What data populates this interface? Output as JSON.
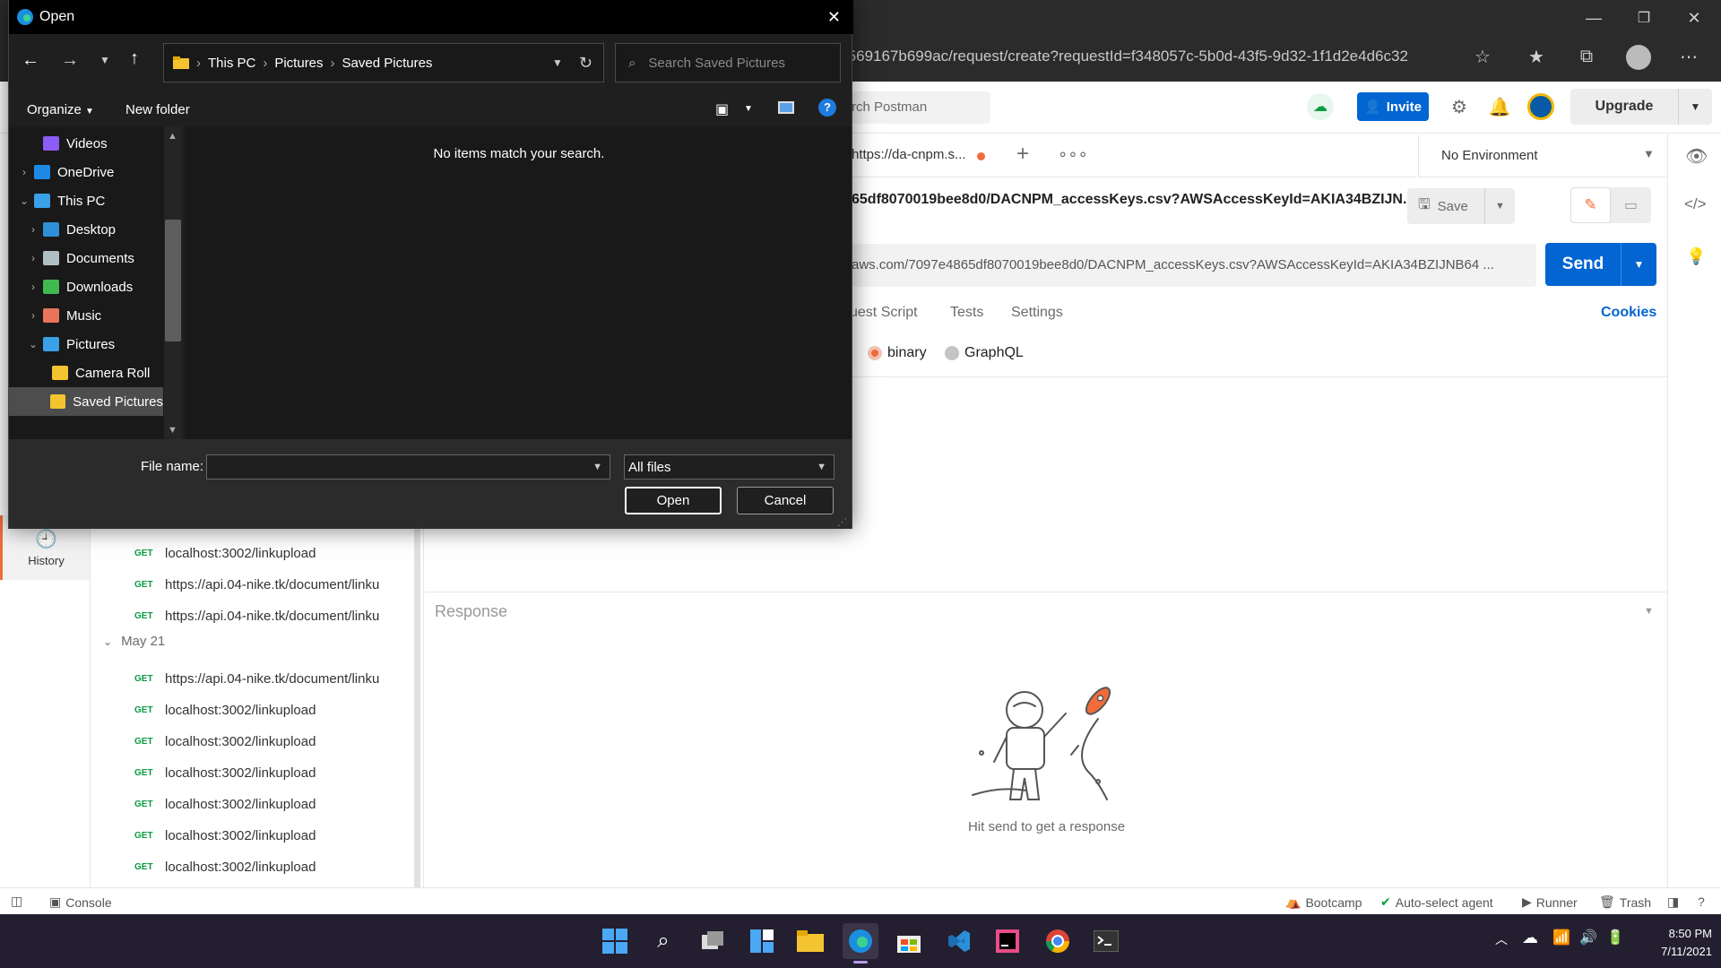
{
  "browser": {
    "url": "-569167b699ac/request/create?requestId=f348057c-5b0d-43f5-9d32-1f1d2e4d6c32"
  },
  "postman": {
    "search_placeholder": "rch Postman",
    "invite_label": "Invite",
    "upgrade_label": "Upgrade",
    "tab_label": "https://da-cnpm.s...",
    "environment": "No Environment",
    "request_name": "65df8070019bee8d0/DACNPM_accessKeys.csv?AWSAccessKeyId=AKIA34BZIJN...",
    "save_label": "Save",
    "request_url": "aws.com/7097e4865df8070019bee8d0/DACNPM_accessKeys.csv?AWSAccessKeyId=AKIA34BZIJNB64 ...",
    "send_label": "Send",
    "request_tabs": [
      "uest Script",
      "Tests",
      "Settings"
    ],
    "cookies_label": "Cookies",
    "body_types": [
      "binary",
      "GraphQL"
    ],
    "history_label": "History",
    "history_top": [
      {
        "method": "GET",
        "url": "localhost:3002/linkupload"
      },
      {
        "method": "GET",
        "url": "https://api.04-nike.tk/document/linku"
      },
      {
        "method": "GET",
        "url": "https://api.04-nike.tk/document/linku"
      }
    ],
    "history_group_date": "May 21",
    "history_group": [
      {
        "method": "GET",
        "url": "https://api.04-nike.tk/document/linku"
      },
      {
        "method": "GET",
        "url": "localhost:3002/linkupload"
      },
      {
        "method": "GET",
        "url": "localhost:3002/linkupload"
      },
      {
        "method": "GET",
        "url": "localhost:3002/linkupload"
      },
      {
        "method": "GET",
        "url": "localhost:3002/linkupload"
      },
      {
        "method": "GET",
        "url": "localhost:3002/linkupload"
      },
      {
        "method": "GET",
        "url": "localhost:3002/linkupload"
      }
    ],
    "response_label": "Response",
    "empty_response": "Hit send to get a response",
    "statusbar": {
      "console": "Console",
      "bootcamp": "Bootcamp",
      "agent": "Auto-select agent",
      "runner": "Runner",
      "trash": "Trash"
    }
  },
  "dialog": {
    "title": "Open",
    "path": [
      "This PC",
      "Pictures",
      "Saved Pictures"
    ],
    "search_placeholder": "Search Saved Pictures",
    "organize_label": "Organize",
    "new_folder_label": "New folder",
    "tree": [
      {
        "label": "Videos",
        "icon": "videos-icon",
        "indent": 1,
        "chevron": ""
      },
      {
        "label": "OneDrive",
        "icon": "onedrive-icon",
        "indent": 0,
        "chevron": "›"
      },
      {
        "label": "This PC",
        "icon": "this-pc-icon",
        "indent": 0,
        "chevron": "⌄"
      },
      {
        "label": "Desktop",
        "icon": "desktop-icon",
        "indent": 1,
        "chevron": "›"
      },
      {
        "label": "Documents",
        "icon": "documents-icon",
        "indent": 1,
        "chevron": "›"
      },
      {
        "label": "Downloads",
        "icon": "downloads-icon",
        "indent": 1,
        "chevron": "›"
      },
      {
        "label": "Music",
        "icon": "music-icon",
        "indent": 1,
        "chevron": "›"
      },
      {
        "label": "Pictures",
        "icon": "pictures-icon",
        "indent": 1,
        "chevron": "⌄"
      },
      {
        "label": "Camera Roll",
        "icon": "folder-icon",
        "indent": 2,
        "chevron": ""
      },
      {
        "label": "Saved Pictures",
        "icon": "folder-icon",
        "indent": 2,
        "chevron": "",
        "selected": true
      }
    ],
    "empty_message": "No items match your search.",
    "file_name_label": "File name:",
    "file_name_value": "",
    "file_type": "All files",
    "open_label": "Open",
    "cancel_label": "Cancel"
  },
  "taskbar": {
    "time": "8:50 PM",
    "date": "7/11/2021"
  },
  "colors": {
    "accent_blue": "#0265d2",
    "postman_orange": "#f26b3a",
    "dialog_bg": "#1f1f1f"
  }
}
